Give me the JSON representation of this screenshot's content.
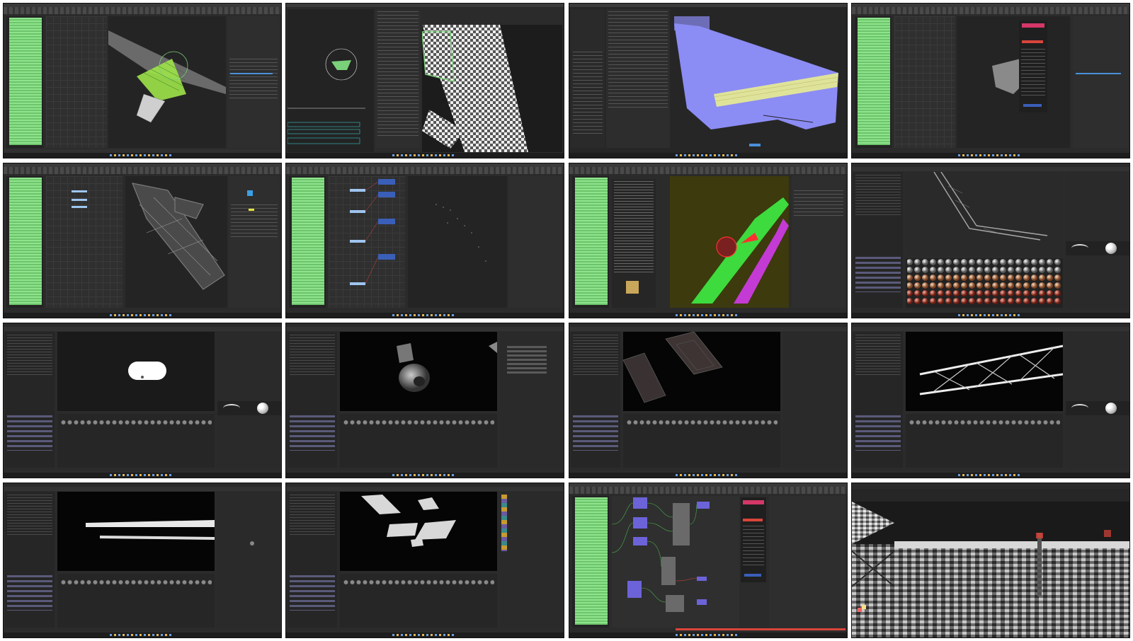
{
  "contact_sheet": {
    "tile_count": 16,
    "tiles": [
      {
        "app": "maya",
        "scene": "green-selected-wireframe-checker"
      },
      {
        "app": "maya-uv",
        "scene": "checker-uv-editor"
      },
      {
        "app": "maya-uv",
        "scene": "purple-uv-shell"
      },
      {
        "app": "maya",
        "scene": "exporter-plugin-panel"
      },
      {
        "app": "maya",
        "scene": "gray-bridge-model"
      },
      {
        "app": "maya",
        "scene": "node-editor-points"
      },
      {
        "app": "maya",
        "scene": "colored-parts-yellow-bg"
      },
      {
        "app": "painter",
        "scene": "bridge-with-material-library"
      },
      {
        "app": "painter",
        "scene": "white-capsule-mask"
      },
      {
        "app": "painter",
        "scene": "lamp-part"
      },
      {
        "app": "painter",
        "scene": "metal-plates"
      },
      {
        "app": "painter",
        "scene": "truss-bridge"
      },
      {
        "app": "painter",
        "scene": "long-beam"
      },
      {
        "app": "painter",
        "scene": "scattered-plates"
      },
      {
        "app": "maya",
        "scene": "hypershade-node-graph"
      },
      {
        "app": "render",
        "scene": "pixelated-bridge-closeup"
      }
    ]
  },
  "colors": {
    "selection_green": "#7bd07a",
    "uv_purple": "#8c8cf5",
    "uv_yellow": "#dfe39a",
    "node_purple": "#6c63d9",
    "accent_red": "#d9453b",
    "accent_blue": "#4a90d9"
  },
  "icons": {
    "material_sphere": "sphere-icon",
    "curve_preview": "curve-icon"
  }
}
